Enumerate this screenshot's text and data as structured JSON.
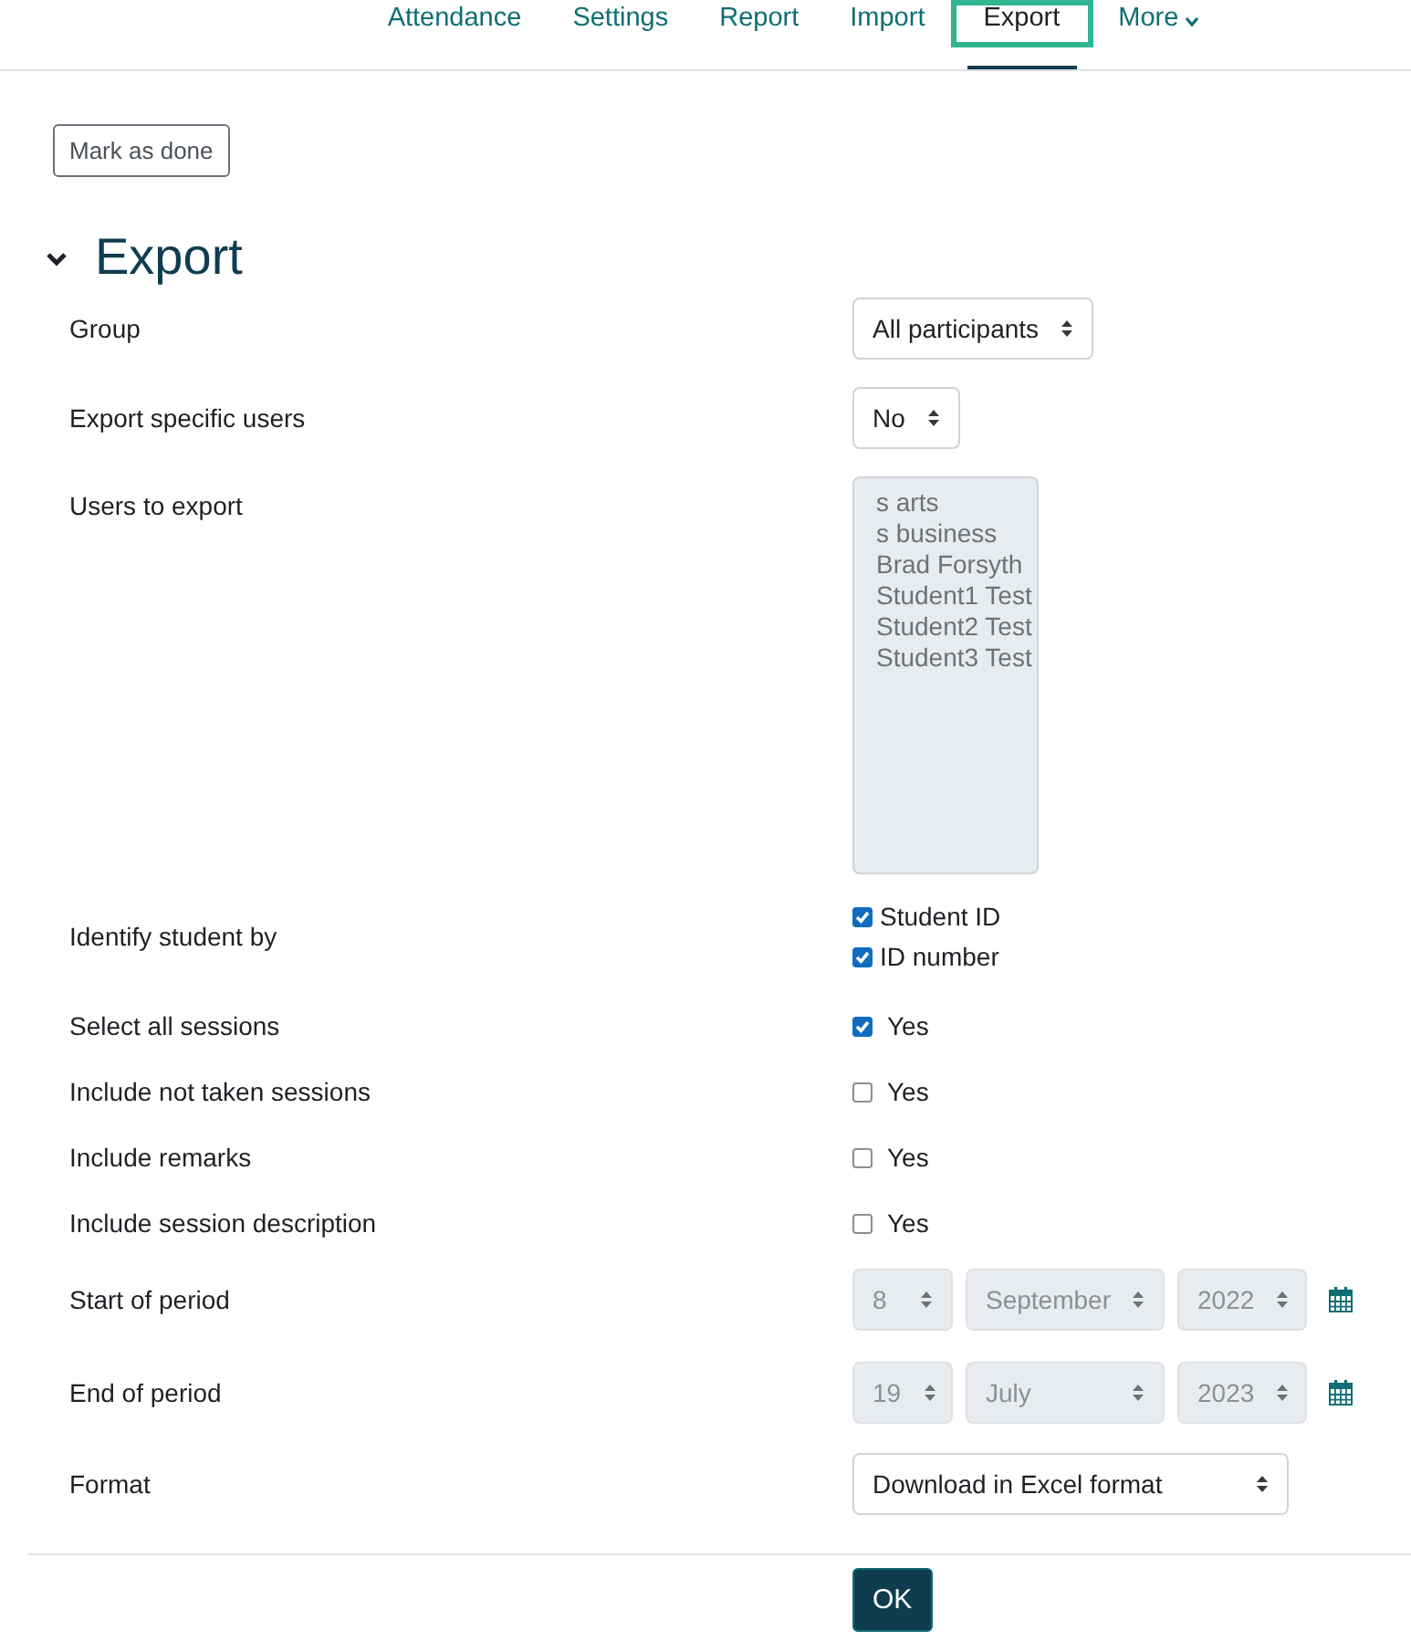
{
  "nav": [
    {
      "label": "Attendance",
      "selected": false
    },
    {
      "label": "Settings",
      "selected": false
    },
    {
      "label": "Report",
      "selected": false
    },
    {
      "label": "Import",
      "selected": false
    },
    {
      "label": "Export",
      "selected": true
    },
    {
      "label": "More",
      "selected": false,
      "dropdown": true
    }
  ],
  "mark_done": "Mark as done",
  "section": {
    "title": "Export",
    "expanded": true
  },
  "fields": [
    {
      "kind": "select",
      "label": "Group",
      "value": "All participants"
    },
    {
      "kind": "select",
      "label": "Export specific users",
      "value": "No"
    },
    {
      "kind": "listbox",
      "label": "Users to export",
      "disabled": true,
      "options": [
        "s arts",
        "s business",
        "Brad Forsyth",
        "Student1 Test",
        "Student2 Test",
        "Student3 Test"
      ]
    },
    {
      "kind": "checkboxes",
      "label": "Identify student by",
      "options": [
        {
          "label": "Student ID",
          "checked": true
        },
        {
          "label": "ID number",
          "checked": true
        }
      ]
    },
    {
      "kind": "checkbox",
      "label": "Select all sessions",
      "option": "Yes",
      "checked": true
    },
    {
      "kind": "checkbox",
      "label": "Include not taken sessions",
      "option": "Yes",
      "checked": false
    },
    {
      "kind": "checkbox",
      "label": "Include remarks",
      "option": "Yes",
      "checked": false
    },
    {
      "kind": "checkbox",
      "label": "Include session description",
      "option": "Yes",
      "checked": false
    },
    {
      "kind": "date",
      "label": "Start of period",
      "disabled": true,
      "day": "8",
      "month": "September",
      "year": "2022"
    },
    {
      "kind": "date",
      "label": "End of period",
      "disabled": true,
      "day": "19",
      "month": "July",
      "year": "2023"
    },
    {
      "kind": "select",
      "label": "Format",
      "value": "Download in Excel format",
      "wide": true
    }
  ],
  "submit": "OK"
}
